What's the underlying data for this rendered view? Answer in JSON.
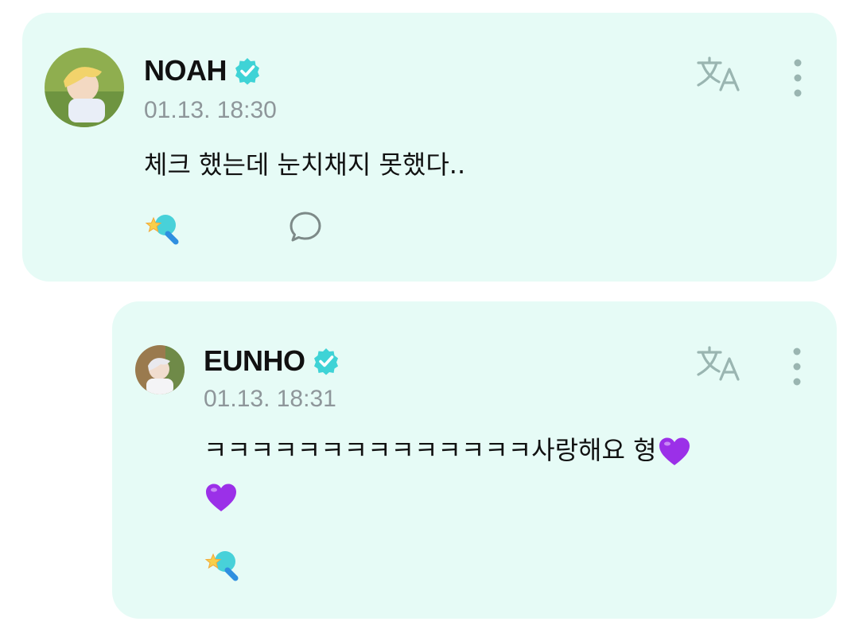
{
  "posts": [
    {
      "author": "NOAH",
      "verified": true,
      "timestamp": "01.13. 18:30",
      "message": "체크 했는데 눈치채지 못했다..",
      "actions": [
        "react-icon",
        "comment-icon"
      ]
    },
    {
      "author": "EUNHO",
      "verified": true,
      "timestamp": "01.13. 18:31",
      "message": "ㅋㅋㅋㅋㅋㅋㅋㅋㅋㅋㅋㅋㅋㅋ사랑해요 형",
      "actions": [
        "react-icon"
      ]
    }
  ],
  "icons": {
    "verified_badge": "verified-badge-icon",
    "translate": "translate-icon",
    "more": "more-vertical-icon",
    "heart": "purple-heart-emoji"
  },
  "colors": {
    "card_background": "#e6fbf6",
    "verified_badge": "#3fd3d6",
    "icon_gray": "#9ab5b1",
    "heart": "#9b30e8",
    "timestamp": "#8e969a"
  }
}
